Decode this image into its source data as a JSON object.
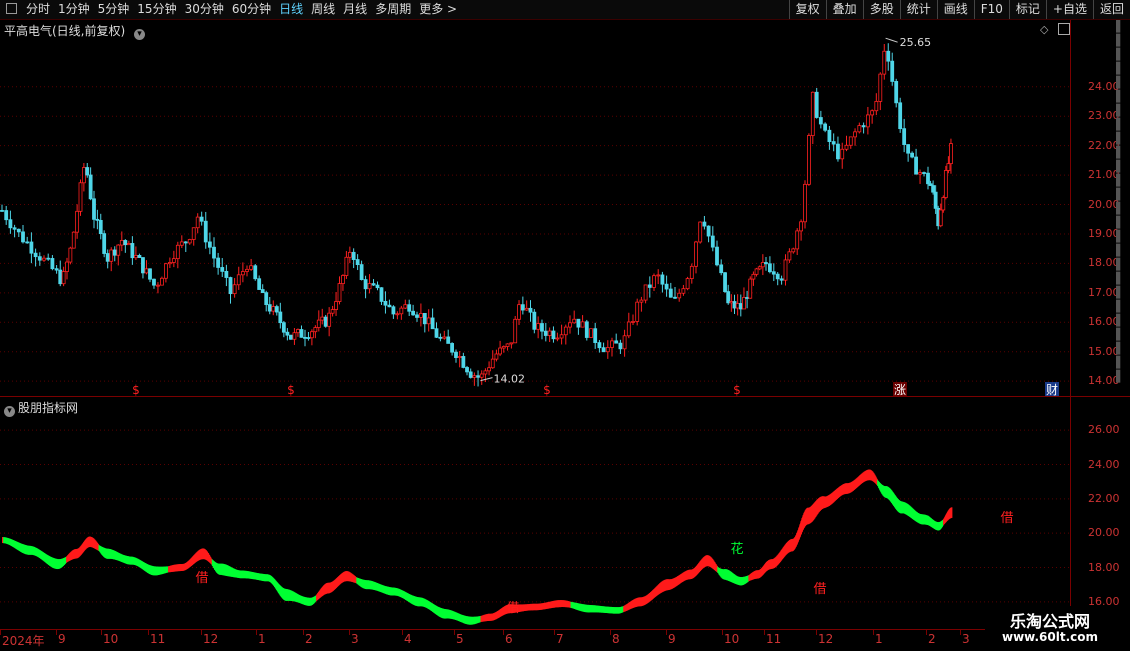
{
  "toolbar": {
    "periods": [
      "分时",
      "1分钟",
      "5分钟",
      "15分钟",
      "30分钟",
      "60分钟",
      "日线",
      "周线",
      "月线",
      "多周期",
      "更多 >"
    ],
    "active_period": "日线",
    "right_buttons": [
      "复权",
      "叠加",
      "多股",
      "统计",
      "画线",
      "F10",
      "标记",
      "+自选",
      "返回"
    ]
  },
  "main_panel": {
    "title": "平高电气(日线,前复权)",
    "high_label": "25.65",
    "low_label": "14.02",
    "y_ticks": [
      "24.00",
      "23.00",
      "22.00",
      "21.00",
      "20.00",
      "19.00",
      "18.00",
      "17.00",
      "16.00",
      "15.00",
      "14.00"
    ],
    "markers": [
      "$",
      "$",
      "$",
      "$",
      "涨",
      "财"
    ]
  },
  "indicator_panel": {
    "title": "股朋指标网",
    "y_ticks": [
      "26.00",
      "24.00",
      "22.00",
      "20.00",
      "18.00",
      "16.00"
    ],
    "labels": [
      "借",
      "借",
      "花",
      "借",
      "借"
    ]
  },
  "date_axis": [
    "2024年",
    "9",
    "10",
    "11",
    "12",
    "1",
    "2",
    "3",
    "4",
    "5",
    "6",
    "7",
    "8",
    "9",
    "10",
    "11",
    "12",
    "1",
    "2",
    "3"
  ],
  "watermark": {
    "name": "乐淘公式网",
    "url": "www.60lt.com"
  },
  "chart_data": [
    {
      "type": "candlestick",
      "title": "平高电气(日线,前复权)",
      "ylim": [
        13.7,
        26.2
      ],
      "categories": [
        "2024年",
        "9",
        "10",
        "11",
        "12",
        "1",
        "2",
        "3",
        "4",
        "5",
        "6",
        "7",
        "8",
        "9",
        "10",
        "11",
        "12",
        "1",
        "2",
        "3"
      ],
      "close_path": [
        {
          "x": 0.0,
          "y": 19.8
        },
        {
          "x": 0.3,
          "y": 19.0
        },
        {
          "x": 0.6,
          "y": 18.4
        },
        {
          "x": 0.9,
          "y": 17.8
        },
        {
          "x": 1.1,
          "y": 17.4
        },
        {
          "x": 1.3,
          "y": 18.6
        },
        {
          "x": 1.6,
          "y": 21.5
        },
        {
          "x": 1.8,
          "y": 19.6
        },
        {
          "x": 2.1,
          "y": 18.2
        },
        {
          "x": 2.4,
          "y": 18.8
        },
        {
          "x": 2.8,
          "y": 18.0
        },
        {
          "x": 3.1,
          "y": 17.2
        },
        {
          "x": 3.4,
          "y": 18.3
        },
        {
          "x": 3.7,
          "y": 18.8
        },
        {
          "x": 3.9,
          "y": 19.6
        },
        {
          "x": 4.2,
          "y": 18.2
        },
        {
          "x": 4.5,
          "y": 17.0
        },
        {
          "x": 4.8,
          "y": 18.0
        },
        {
          "x": 5.1,
          "y": 16.8
        },
        {
          "x": 5.4,
          "y": 16.2
        },
        {
          "x": 5.7,
          "y": 15.5
        },
        {
          "x": 6.1,
          "y": 15.7
        },
        {
          "x": 6.5,
          "y": 16.1
        },
        {
          "x": 6.8,
          "y": 17.4
        },
        {
          "x": 7.0,
          "y": 18.6
        },
        {
          "x": 7.2,
          "y": 17.4
        },
        {
          "x": 7.5,
          "y": 17.0
        },
        {
          "x": 7.8,
          "y": 16.3
        },
        {
          "x": 8.1,
          "y": 16.6
        },
        {
          "x": 8.4,
          "y": 16.1
        },
        {
          "x": 8.7,
          "y": 15.4
        },
        {
          "x": 9.0,
          "y": 15.0
        },
        {
          "x": 9.3,
          "y": 14.3
        },
        {
          "x": 9.5,
          "y": 14.1
        },
        {
          "x": 9.8,
          "y": 14.9
        },
        {
          "x": 10.1,
          "y": 15.2
        },
        {
          "x": 10.3,
          "y": 16.8
        },
        {
          "x": 10.6,
          "y": 15.8
        },
        {
          "x": 11.0,
          "y": 15.6
        },
        {
          "x": 11.3,
          "y": 16.2
        },
        {
          "x": 11.6,
          "y": 15.6
        },
        {
          "x": 11.9,
          "y": 15.1
        },
        {
          "x": 12.2,
          "y": 15.3
        },
        {
          "x": 12.5,
          "y": 16.8
        },
        {
          "x": 12.8,
          "y": 17.6
        },
        {
          "x": 13.1,
          "y": 16.6
        },
        {
          "x": 13.4,
          "y": 17.8
        },
        {
          "x": 13.6,
          "y": 19.8
        },
        {
          "x": 13.8,
          "y": 18.4
        },
        {
          "x": 14.1,
          "y": 16.6
        },
        {
          "x": 14.4,
          "y": 16.5
        },
        {
          "x": 14.7,
          "y": 17.5
        },
        {
          "x": 15.0,
          "y": 18.0
        },
        {
          "x": 15.3,
          "y": 17.6
        },
        {
          "x": 15.5,
          "y": 18.5
        },
        {
          "x": 15.7,
          "y": 19.8
        },
        {
          "x": 15.9,
          "y": 23.6
        },
        {
          "x": 16.1,
          "y": 22.4
        },
        {
          "x": 16.4,
          "y": 21.6
        },
        {
          "x": 16.7,
          "y": 22.6
        },
        {
          "x": 17.0,
          "y": 23.2
        },
        {
          "x": 17.2,
          "y": 25.6
        },
        {
          "x": 17.4,
          "y": 23.4
        },
        {
          "x": 17.6,
          "y": 21.6
        },
        {
          "x": 17.9,
          "y": 21.0
        },
        {
          "x": 18.1,
          "y": 20.6
        },
        {
          "x": 18.3,
          "y": 19.4
        },
        {
          "x": 18.5,
          "y": 20.8
        },
        {
          "x": 18.7,
          "y": 22.0
        }
      ]
    },
    {
      "type": "area",
      "title": "股朋指标网",
      "ylim": [
        15.0,
        27.0
      ],
      "x": [
        0.0,
        0.5,
        1.0,
        1.4,
        1.7,
        2.1,
        2.6,
        3.1,
        3.6,
        4.0,
        4.3,
        4.7,
        5.2,
        5.6,
        6.1,
        6.5,
        6.9,
        7.3,
        7.8,
        8.3,
        8.8,
        9.3,
        9.7,
        10.1,
        10.6,
        11.1,
        11.6,
        12.1,
        12.5,
        13.0,
        13.4,
        13.7,
        14.0,
        14.4,
        14.8,
        15.1,
        15.5,
        15.8,
        16.1,
        16.5,
        16.9,
        17.2,
        17.5,
        17.9,
        18.3,
        18.7
      ],
      "values": [
        19.6,
        19.0,
        18.2,
        18.8,
        19.5,
        18.8,
        18.4,
        17.8,
        18.0,
        18.8,
        17.9,
        17.6,
        17.4,
        16.4,
        16.0,
        16.8,
        17.5,
        17.0,
        16.6,
        16.0,
        15.3,
        14.9,
        15.1,
        15.6,
        15.7,
        15.9,
        15.6,
        15.5,
        16.0,
        17.0,
        17.6,
        18.4,
        17.6,
        17.2,
        17.6,
        18.2,
        19.3,
        21.0,
        21.8,
        22.6,
        23.4,
        22.4,
        21.5,
        20.8,
        20.4,
        21.2
      ],
      "up_color": "#ff1a1a",
      "down_color": "#00ff33"
    }
  ]
}
